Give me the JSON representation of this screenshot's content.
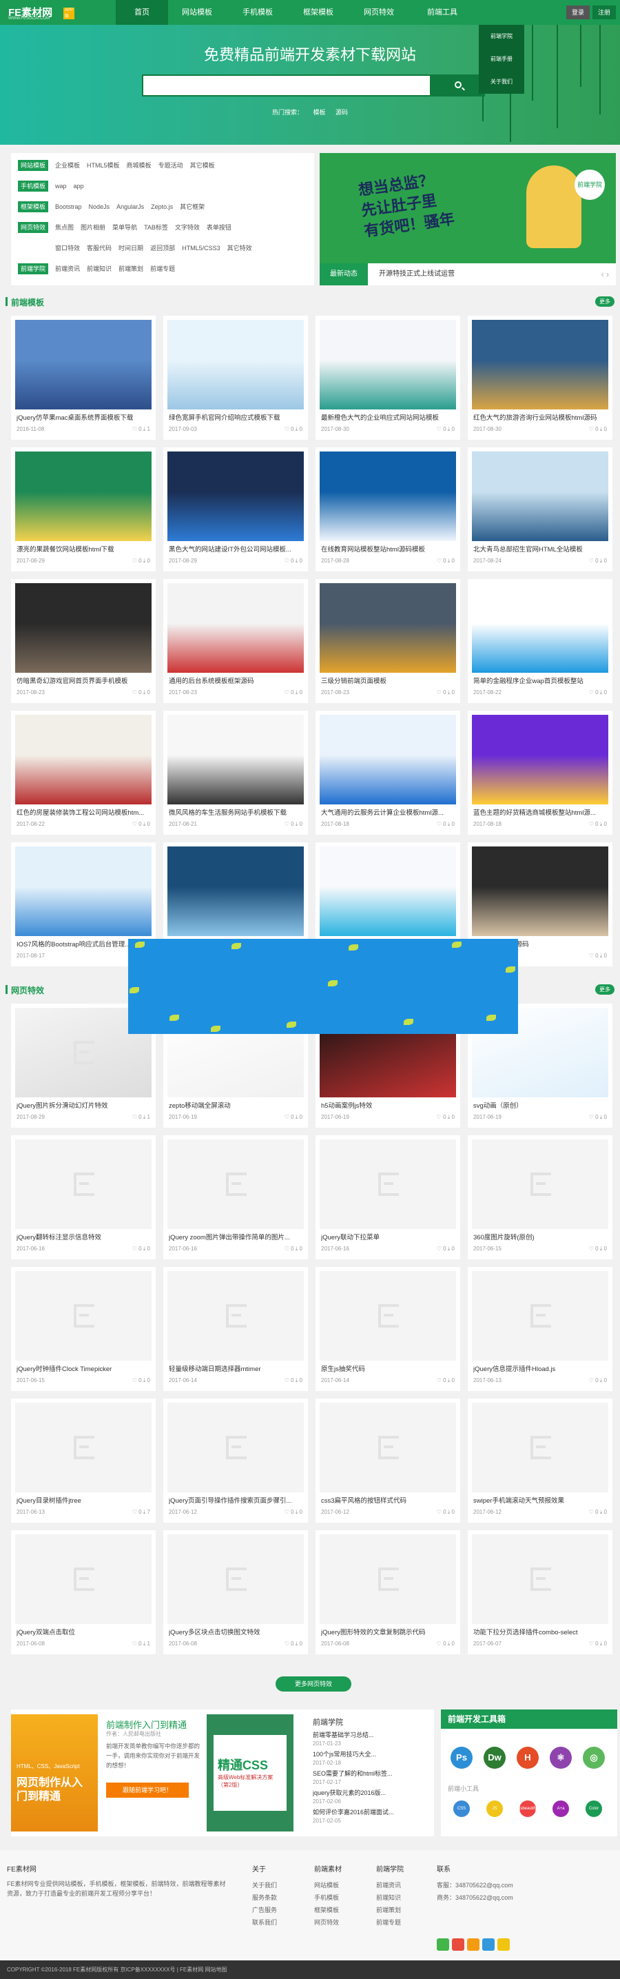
{
  "header": {
    "logo": "FE素材网",
    "logo_badge": "APP版",
    "logo_sub": "WWW.FESUCAI.COM",
    "nav": [
      "首页",
      "网站模板",
      "手机模板",
      "框架模板",
      "网页特效",
      "前端工具"
    ],
    "login": "登录",
    "register": "注册",
    "dropdown": [
      "前端学院",
      "前端手册",
      "关于我们"
    ]
  },
  "banner": {
    "title": "免费精品前端开发素材下载网站",
    "hot_label": "热门搜索：",
    "hot": [
      "模板",
      "源码"
    ]
  },
  "categories": [
    {
      "tag": "网站模板",
      "links": [
        "企业模板",
        "HTML5模板",
        "商城模板",
        "专题活动",
        "其它模板"
      ]
    },
    {
      "tag": "手机模板",
      "links": [
        "wap",
        "app"
      ]
    },
    {
      "tag": "框架模板",
      "links": [
        "Bootstrap",
        "NodeJs",
        "AngularJs",
        "Zepto.js",
        "其它框架"
      ]
    },
    {
      "tag": "网页特效",
      "links": [
        "焦点图",
        "图片相册",
        "菜单导航",
        "TAB标签",
        "文字特效",
        "表单按钮"
      ]
    },
    {
      "tag": "",
      "links": [
        "窗口特效",
        "客服代码",
        "时间日期",
        "返回顶部",
        "HTML5/CSS3",
        "其它特效"
      ]
    },
    {
      "tag": "前端学院",
      "links": [
        "前端资讯",
        "前端知识",
        "前端策划",
        "前端专题"
      ]
    }
  ],
  "promo": {
    "line1": "想当总监？",
    "line2": "先让肚子里",
    "line3": "有货吧！骚年",
    "badge": "前端学院"
  },
  "news": {
    "tag": "最新动态",
    "text": "开源特技正式上线试运营"
  },
  "sections": {
    "templates": "前端模板",
    "effects": "网页特效",
    "more": "更多"
  },
  "templates": [
    {
      "title": "jQuery仿苹果mac桌面系统界面模板下载",
      "date": "2016-11-08",
      "likes": "0",
      "downloads": "1"
    },
    {
      "title": "绿色宽屏手机官网介绍响应式模板下载",
      "date": "2017-09-03",
      "likes": "0",
      "downloads": "0"
    },
    {
      "title": "最新橙色大气的企业响应式网站网站模板",
      "date": "2017-08-30",
      "likes": "0",
      "downloads": "0"
    },
    {
      "title": "红色大气的旅游咨询行业网站模板html源码",
      "date": "2017-08-30",
      "likes": "0",
      "downloads": "0"
    },
    {
      "title": "漂亮的果蔬餐饮网站模板html下载",
      "date": "2017-08-29",
      "likes": "0",
      "downloads": "0"
    },
    {
      "title": "黑色大气的网站建设IT外包公司网站模板...",
      "date": "2017-08-29",
      "likes": "0",
      "downloads": "0"
    },
    {
      "title": "在线教育网站模板整站html源码模板",
      "date": "2017-08-28",
      "likes": "0",
      "downloads": "0"
    },
    {
      "title": "北大青鸟总部招生官网HTML全站模板",
      "date": "2017-08-24",
      "likes": "0",
      "downloads": "0"
    },
    {
      "title": "仿暗黑奇幻游戏官网首页界面手机模板",
      "date": "2017-08-23",
      "likes": "0",
      "downloads": "0"
    },
    {
      "title": "通用的后台系统模板框架源码",
      "date": "2017-08-23",
      "likes": "0",
      "downloads": "0"
    },
    {
      "title": "三级分销前端页面模板",
      "date": "2017-08-23",
      "likes": "0",
      "downloads": "0"
    },
    {
      "title": "简单的金融程序企业wap首页模板整站",
      "date": "2017-08-22",
      "likes": "0",
      "downloads": "0"
    },
    {
      "title": "红色的房屋装修装饰工程公司网站模板htm...",
      "date": "2017-08-22",
      "likes": "0",
      "downloads": "0"
    },
    {
      "title": "微风风格的车生活服务网站手机模板下载",
      "date": "2017-08-21",
      "likes": "0",
      "downloads": "0"
    },
    {
      "title": "大气通用的云服务云计算企业模板html源...",
      "date": "2017-08-18",
      "likes": "0",
      "downloads": "0"
    },
    {
      "title": "蓝色主题的好货精选商城模板整站html源...",
      "date": "2017-08-18",
      "likes": "0",
      "downloads": "0"
    },
    {
      "title": "IOS7风格的Bootstrap响应式后台管理...",
      "date": "2017-08-17",
      "likes": "0",
      "downloads": "0"
    },
    {
      "title": "",
      "date": "",
      "likes": "",
      "downloads": ""
    },
    {
      "title": "",
      "date": "",
      "likes": "",
      "downloads": ""
    },
    {
      "title": "...app网站模板源码",
      "date": "",
      "likes": "0",
      "downloads": "0"
    }
  ],
  "effects": [
    {
      "title": "jQuery图片拆分滑动幻灯片特效",
      "date": "2017-08-29",
      "likes": "0",
      "downloads": "1"
    },
    {
      "title": "zepto移动端全屏滚动",
      "date": "2017-06-19",
      "likes": "0",
      "downloads": "0"
    },
    {
      "title": "h5动画案例js特效",
      "date": "2017-06-19",
      "likes": "0",
      "downloads": "0"
    },
    {
      "title": "svg动画（原创）",
      "date": "2017-06-19",
      "likes": "0",
      "downloads": "0"
    },
    {
      "title": "jQuery翻转标注显示信息特效",
      "date": "2017-06-16",
      "likes": "0",
      "downloads": "0"
    },
    {
      "title": "jQuery zoom图片弹出带操作简单的图片...",
      "date": "2017-06-16",
      "likes": "0",
      "downloads": "0"
    },
    {
      "title": "jQuery联动下拉菜单",
      "date": "2017-06-16",
      "likes": "0",
      "downloads": "0"
    },
    {
      "title": "360度图片旋转(原创)",
      "date": "2017-06-15",
      "likes": "0",
      "downloads": "0"
    },
    {
      "title": "jQuery时钟插件Clock Timepicker",
      "date": "2017-06-15",
      "likes": "0",
      "downloads": "0"
    },
    {
      "title": "轻量级移动端日期选择器mtimer",
      "date": "2017-06-14",
      "likes": "0",
      "downloads": "0"
    },
    {
      "title": "原生js抽奖代码",
      "date": "2017-06-14",
      "likes": "0",
      "downloads": "0"
    },
    {
      "title": "jQuery信息提示插件Hload.js",
      "date": "2017-06-13",
      "likes": "0",
      "downloads": "0"
    },
    {
      "title": "jQuery目录树插件jtree",
      "date": "2017-06-13",
      "likes": "0",
      "downloads": "7"
    },
    {
      "title": "jQuery页面引导操作插件搜索页面步骤引...",
      "date": "2017-06-12",
      "likes": "0",
      "downloads": "0"
    },
    {
      "title": "css3扁平风格的按钮样式代码",
      "date": "2017-06-12",
      "likes": "0",
      "downloads": "0"
    },
    {
      "title": "swiper手机端滚动天气预报效果",
      "date": "2017-06-12",
      "likes": "0",
      "downloads": "0"
    },
    {
      "title": "jQuery双端点击取位",
      "date": "2017-06-08",
      "likes": "0",
      "downloads": "1"
    },
    {
      "title": "jQuery多区块点击切换图文特效",
      "date": "2017-06-08",
      "likes": "0",
      "downloads": "0"
    },
    {
      "title": "jQuery图形特效的文章复制跳示代码",
      "date": "2017-06-08",
      "likes": "0",
      "downloads": "0"
    },
    {
      "title": "功能下拉分页选择插件combo-select",
      "date": "2017-06-07",
      "likes": "0",
      "downloads": "0"
    }
  ],
  "more_effects": "更多网页特效",
  "book1": {
    "title": "前端制作入门到精通",
    "author": "作者：人民邮电出版社",
    "desc": "前端开发简单教你编写中你逐步都的一手，调用来你实现你对于前端开发的想想！",
    "btn": "跟随前端学习吧！",
    "cover_text": "网页制作从入门到精通",
    "cover_top": "HTML、CSS、JavaScript"
  },
  "book2": {
    "cover_text": "精通CSS",
    "cover_sub": "高级Web标准解决方案（第2版）"
  },
  "learn": {
    "title": "前端学院",
    "items": [
      {
        "text": "前端零基础学习总结...",
        "date": "2017-01-23"
      },
      {
        "text": "100个js常用技巧大全...",
        "date": "2017-02-18"
      },
      {
        "text": "SEO需要了解的和html标签...",
        "date": "2017-02-17"
      },
      {
        "text": "jquery获取元素的2016版...",
        "date": "2017-02-06"
      },
      {
        "text": "如何评价李嘉2016前端面试...",
        "date": "2017-02-05"
      }
    ]
  },
  "tools": {
    "title": "前端开发工具箱",
    "sub": "前端小工具",
    "icons": [
      "Ps",
      "Dw",
      "H",
      "⚛",
      "◎"
    ],
    "icon_colors": [
      "#2c8fd6",
      "#2e7d32",
      "#e44d26",
      "#8e44ad",
      "#5cb85c"
    ],
    "mini": [
      "CSS",
      "JS",
      "jsbeautify",
      "A+a",
      "Color"
    ],
    "mini_colors": [
      "#3a8bd6",
      "#f0c419",
      "#e44",
      "#9c27b0",
      "#1b9b53"
    ]
  },
  "footer": {
    "about_title": "FE素材网",
    "about_text": "FE素材网专业提供网站模板，手机模板，框架模板，前端特效，前端教程等素材资源，致力于打造最专业的前端开发工程师分享平台！",
    "cols": [
      {
        "title": "关于",
        "items": [
          "关于我们",
          "服务条款",
          "广告服务",
          "联系我们"
        ]
      },
      {
        "title": "前端素材",
        "items": [
          "网站模板",
          "手机模板",
          "框架模板",
          "网页特效"
        ]
      },
      {
        "title": "前端学院",
        "items": [
          "前端资讯",
          "前端知识",
          "前端策划",
          "前端专题"
        ]
      },
      {
        "title": "联系",
        "items": [
          "客服：348705622@qq.com",
          "商务：348705622@qq.com"
        ]
      }
    ],
    "copyright": "COPYRIGHT ©2016-2018 FE素材网版权所有 京ICP备XXXXXXXX号 | FE素材网 网站地图"
  }
}
